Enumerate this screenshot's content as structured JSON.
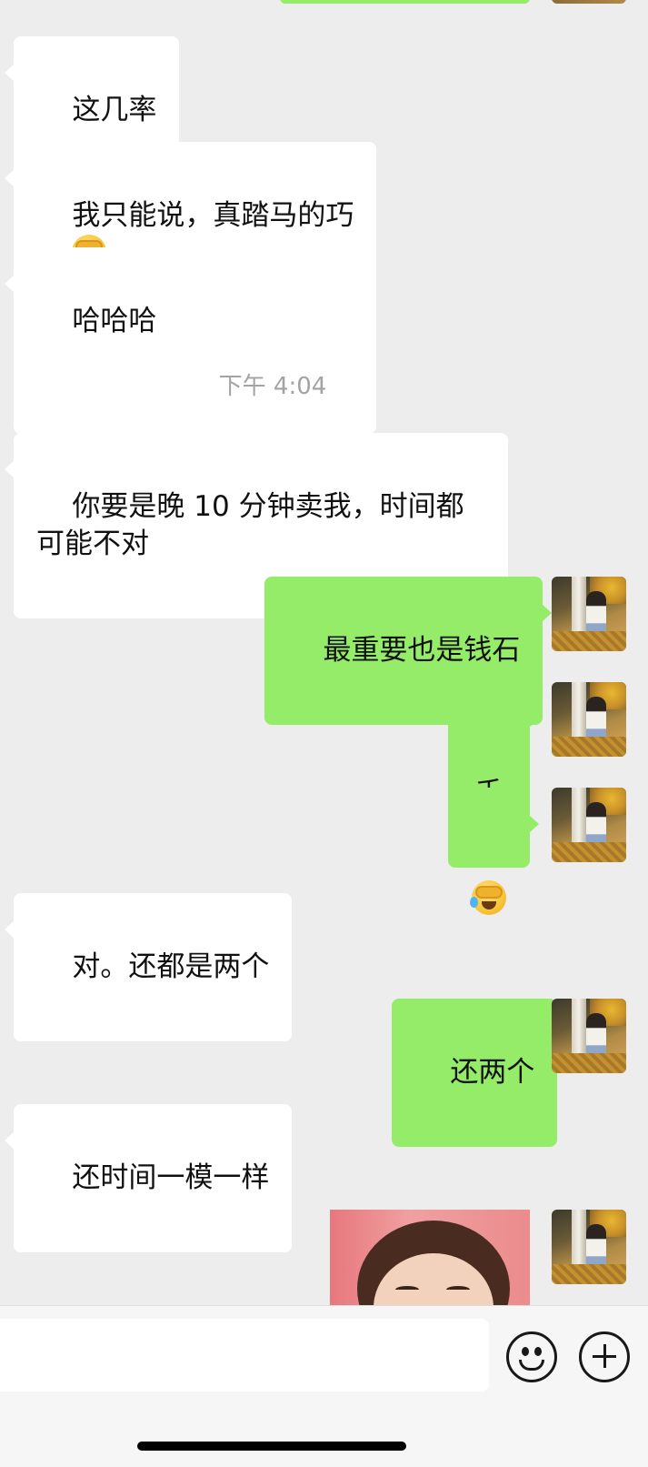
{
  "timestamp": "下午 4:04",
  "messages": [
    {
      "side": "in",
      "text": "这几率"
    },
    {
      "side": "in",
      "text": "我只能说，真踏马的巧"
    },
    {
      "side": "in",
      "text": "哈哈哈"
    },
    {
      "side": "in",
      "text": "你要是晚 10 分钟卖我，时间都可能不对"
    },
    {
      "side": "out",
      "text": "最重要也是钱石"
    },
    {
      "side": "out",
      "text": "千"
    },
    {
      "side": "out",
      "text": ""
    },
    {
      "side": "in",
      "text": "对。还都是两个"
    },
    {
      "side": "out",
      "text": "还两个"
    },
    {
      "side": "in",
      "text": "还时间一模一样"
    },
    {
      "side": "out",
      "text": ""
    }
  ],
  "emoji_icons": {
    "msg2": "facepalm-laughing-emoji",
    "msg7": "facepalm-laughing-emoji"
  },
  "input": {
    "value": "",
    "placeholder": ""
  },
  "colors": {
    "incoming": "#ffffff",
    "outgoing": "#95ec69",
    "background": "#ededed"
  }
}
